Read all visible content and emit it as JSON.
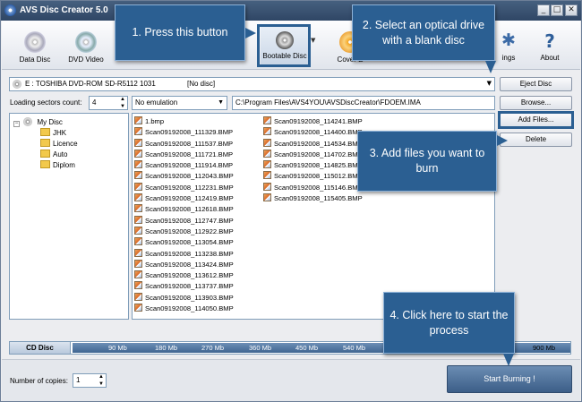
{
  "window": {
    "title": "AVS Disc Creator 5.0",
    "min": "_",
    "max": "□",
    "close": "✕"
  },
  "toolbar": {
    "data_disc": "Data Disc",
    "dvd_video": "DVD Video",
    "bootable_disc": "Bootable Disc",
    "cover": "Cover E",
    "settings": "ings",
    "about": "About"
  },
  "callouts": {
    "c1": "1. Press this button",
    "c2": "2. Select an optical drive with a blank disc",
    "c3": "3. Add files you want to burn",
    "c4": "4. Click here to start the process"
  },
  "drive": {
    "name": "E : TOSHIBA  DVD-ROM SD-R5112 1031",
    "status": "[No disc]"
  },
  "buttons": {
    "eject": "Eject Disc",
    "browse": "Browse...",
    "add_files": "Add Files...",
    "delete": "Delete",
    "start": "Start Burning !"
  },
  "loading": {
    "label": "Loading sectors count:",
    "value": "4",
    "emulation": "No emulation",
    "path": "C:\\Program Files\\AVS4YOU\\AVSDiscCreator\\FDOEM.IMA"
  },
  "tree": {
    "root": "My Disc",
    "folders": [
      "JHK",
      "Licence",
      "Auto",
      "Diplom"
    ]
  },
  "files": {
    "col1": [
      "1.bmp",
      "Scan09192008_111329.BMP",
      "Scan09192008_111537.BMP",
      "Scan09192008_111721.BMP",
      "Scan09192008_111914.BMP",
      "Scan09192008_112043.BMP",
      "Scan09192008_112231.BMP",
      "Scan09192008_112419.BMP",
      "Scan09192008_112618.BMP",
      "Scan09192008_112747.BMP",
      "Scan09192008_112922.BMP",
      "Scan09192008_113054.BMP",
      "Scan09192008_113238.BMP",
      "Scan09192008_113424.BMP",
      "Scan09192008_113612.BMP",
      "Scan09192008_113737.BMP",
      "Scan09192008_113903.BMP",
      "Scan09192008_114050.BMP"
    ],
    "col2": [
      "Scan09192008_114241.BMP",
      "Scan09192008_114400.BMP",
      "Scan09192008_114534.BMP",
      "Scan09192008_114702.BMP",
      "Scan09192008_114825.BMP",
      "Scan09192008_115012.BMP",
      "Scan09192008_115146.BMP",
      "Scan09192008_115405.BMP"
    ]
  },
  "capacity": {
    "disc": "CD Disc",
    "ticks": [
      "90 Mb",
      "180 Mb",
      "270 Mb",
      "360 Mb",
      "450 Mb",
      "540 Mb",
      "900 Mb"
    ]
  },
  "copies": {
    "label": "Number of copies:",
    "value": "1"
  },
  "colors": {
    "accent": "#2b5f92",
    "titlebar": "#2f4665"
  }
}
